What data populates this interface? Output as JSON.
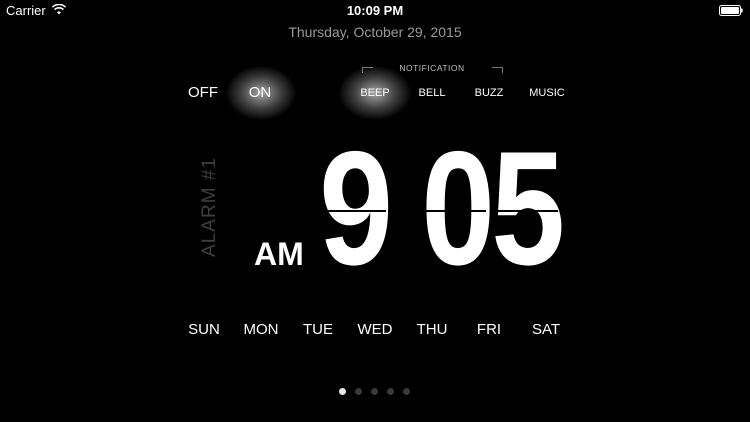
{
  "status_bar": {
    "carrier": "Carrier",
    "time": "10:09 PM",
    "wifi_icon": "wifi-icon",
    "battery_icon": "battery-icon"
  },
  "date": "Thursday, October 29, 2015",
  "toggle": {
    "off_label": "OFF",
    "on_label": "ON",
    "selected": "ON"
  },
  "notification": {
    "label": "NOTIFICATION",
    "options": [
      "BEEP",
      "BELL",
      "BUZZ",
      "MUSIC"
    ],
    "selected": "BEEP"
  },
  "alarm": {
    "label": "ALARM #1",
    "ampm": "AM",
    "hour": "9",
    "minute_tens": "0",
    "minute_ones": "5"
  },
  "days": [
    "SUN",
    "MON",
    "TUE",
    "WED",
    "THU",
    "FRI",
    "SAT"
  ],
  "pager": {
    "total": 5,
    "active": 1
  },
  "colors": {
    "background": "#000000",
    "text": "#ffffff",
    "date": "#9a9a9a",
    "alarm_label": "#3e3e3e"
  }
}
